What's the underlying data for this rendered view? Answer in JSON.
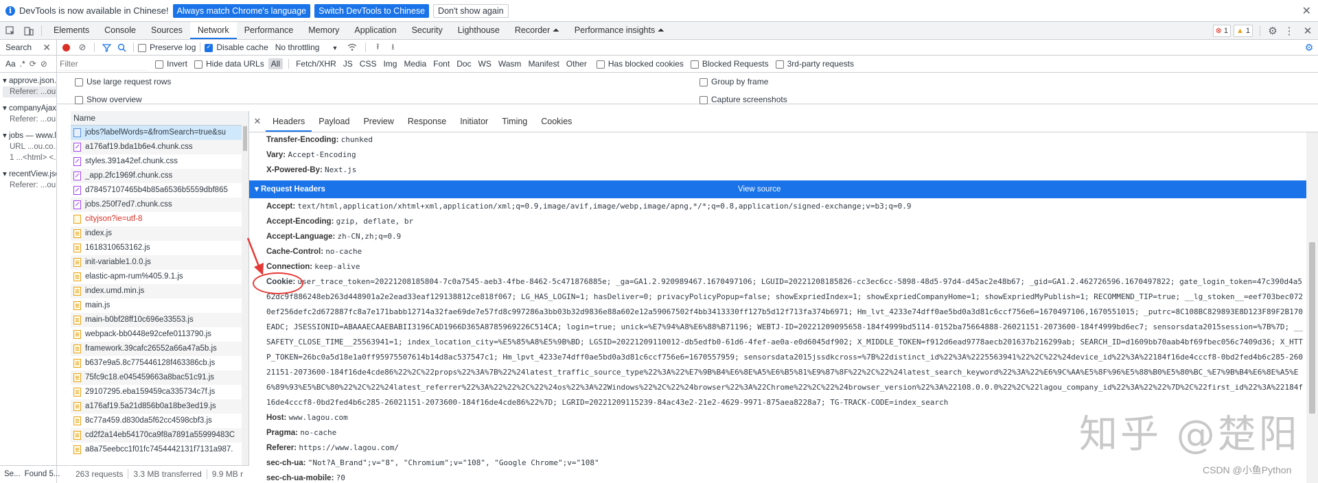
{
  "infobar": {
    "message": "DevTools is now available in Chinese!",
    "btn_match": "Always match Chrome's language",
    "btn_switch": "Switch DevTools to Chinese",
    "btn_dismiss": "Don't show again"
  },
  "main_tabs": [
    "Elements",
    "Console",
    "Sources",
    "Network",
    "Performance",
    "Memory",
    "Application",
    "Security",
    "Lighthouse",
    "Recorder ⏶",
    "Performance insights ⏶"
  ],
  "badges": {
    "errors": "1",
    "warnings": "1"
  },
  "search_panel": {
    "title": "Search",
    "opt_aa": "Aa",
    "opt_regex": ".*",
    "results": [
      {
        "file": "approve.json...",
        "line": "Referer: ...ou..."
      },
      {
        "file": "companyAjax...",
        "line": "Referer: ...ou..."
      },
      {
        "file": "jobs — www.l...",
        "line": "URL ...ou.co...",
        "line2": "1 ...<html> <..."
      },
      {
        "file": "recentView.jso...",
        "line": "Referer: ...ou..."
      }
    ],
    "status_left": "Se...",
    "status_found": "Found 5..."
  },
  "network_toolbar": {
    "preserve_log": "Preserve log",
    "disable_cache": "Disable cache",
    "throttling": "No throttling"
  },
  "filter_bar": {
    "placeholder": "Filter",
    "invert": "Invert",
    "hide_data_urls": "Hide data URLs",
    "types": [
      "All",
      "Fetch/XHR",
      "JS",
      "CSS",
      "Img",
      "Media",
      "Font",
      "Doc",
      "WS",
      "Wasm",
      "Manifest",
      "Other"
    ],
    "has_blocked_cookies": "Has blocked cookies",
    "blocked_requests": "Blocked Requests",
    "third_party": "3rd-party requests"
  },
  "options": {
    "large_rows": "Use large request rows",
    "overview": "Show overview",
    "group_by_frame": "Group by frame",
    "capture_screenshots": "Capture screenshots"
  },
  "request_list": {
    "header": "Name",
    "rows": [
      {
        "name": "jobs?labelWords=&fromSearch=true&su",
        "type": "doc"
      },
      {
        "name": "a176af19.bda1b6e4.chunk.css",
        "type": "css"
      },
      {
        "name": "styles.391a42ef.chunk.css",
        "type": "css"
      },
      {
        "name": "_app.2fc1969f.chunk.css",
        "type": "css"
      },
      {
        "name": "d78457107465b4b85a6536b5559dbf865",
        "type": "css"
      },
      {
        "name": "jobs.250f7ed7.chunk.css",
        "type": "css"
      },
      {
        "name": "cityjson?ie=utf-8",
        "type": "err"
      },
      {
        "name": "index.js",
        "type": "js"
      },
      {
        "name": "1618310653162.js",
        "type": "js"
      },
      {
        "name": "init-variable1.0.0.js",
        "type": "js"
      },
      {
        "name": "elastic-apm-rum%405.9.1.js",
        "type": "js"
      },
      {
        "name": "index.umd.min.js",
        "type": "js"
      },
      {
        "name": "main.js",
        "type": "js"
      },
      {
        "name": "main-b0bf28ff10c696e33553.js",
        "type": "js"
      },
      {
        "name": "webpack-bb0448e92cefe0113790.js",
        "type": "js"
      },
      {
        "name": "framework.39cafc26552a66a47a5b.js",
        "type": "js"
      },
      {
        "name": "b637e9a5.8c775446128f463386cb.js",
        "type": "js"
      },
      {
        "name": "75fc9c18.e045459663a8bac51c91.js",
        "type": "js"
      },
      {
        "name": "29107295.eba159459ca335734c7f.js",
        "type": "js"
      },
      {
        "name": "a176af19.5a21d856b0a18be3ed19.js",
        "type": "js"
      },
      {
        "name": "8c77a459.d830da5f62cc4598cbf3.js",
        "type": "js"
      },
      {
        "name": "cd2f2a14eb54170ca9f8a7891a55999483C",
        "type": "js"
      },
      {
        "name": "a8a75eebcc1f01fc7454442131f7131a987.",
        "type": "js"
      }
    ]
  },
  "statusbar": {
    "requests": "263 requests",
    "transferred": "3.3 MB transferred",
    "resources": "9.9 MB r"
  },
  "detail_tabs": [
    "Headers",
    "Payload",
    "Preview",
    "Response",
    "Initiator",
    "Timing",
    "Cookies"
  ],
  "response_headers": [
    {
      "k": "Transfer-Encoding:",
      "v": "chunked"
    },
    {
      "k": "Vary:",
      "v": "Accept-Encoding"
    },
    {
      "k": "X-Powered-By:",
      "v": "Next.js"
    }
  ],
  "request_section": {
    "title": "Request Headers",
    "view_source": "View source"
  },
  "request_headers_top": [
    {
      "k": "Accept:",
      "v": "text/html,application/xhtml+xml,application/xml;q=0.9,image/avif,image/webp,image/apng,*/*;q=0.8,application/signed-exchange;v=b3;q=0.9"
    },
    {
      "k": "Accept-Encoding:",
      "v": "gzip, deflate, br"
    },
    {
      "k": "Accept-Language:",
      "v": "zh-CN,zh;q=0.9"
    },
    {
      "k": "Cache-Control:",
      "v": "no-cache"
    },
    {
      "k": "Connection:",
      "v": "keep-alive"
    }
  ],
  "cookie": {
    "k": "Cookie:",
    "v": "user_trace_token=20221208185804-7c0a7545-aeb3-4fbe-8462-5c471876885e; _ga=GA1.2.920989467.1670497106; LGUID=20221208185826-cc3ec6cc-5898-48d5-97d4-d45ac2e48b67; _gid=GA1.2.462726596.1670497822; gate_login_token=47c390d4a562dc9f886248eb263d448901a2e2ead33eaf129138812ce818f067; LG_HAS_LOGIN=1; hasDeliver=0; privacyPolicyPopup=false; showExpriedIndex=1; showExpriedCompanyHome=1; showExpriedMyPublish=1; RECOMMEND_TIP=true; __lg_stoken__=eef703bec0720ef256defc2d672887fc8a7e171babb12714a32fae69de7e57fd8c997286a3bb03b32d9836e88a602e12a59067502f4bb3413330ff127b5d12f713fa374b6971; Hm_lvt_4233e74dff0ae5bd0a3d81c6ccf756e6=1670497106,1670551015; _putrc=8C108BC829893E8D123F89F2B170EADC; JSESSIONID=ABAAAECAAEBABII3196CAD1966D365A8785969226C514CA; login=true; unick=%E7%94%A8%E6%88%B71196; WEBTJ-ID=20221209095658-184f4999bd5114-0152ba75664888-26021151-2073600-184f4999bd6ec7; sensorsdata2015session=%7B%7D; __SAFETY_CLOSE_TIME__25563941=1; index_location_city=%E5%85%A8%E5%9B%BD; LGSID=20221209110012-db5edfb0-61d6-4fef-ae0a-e0d6045df902; X_MIDDLE_TOKEN=f912d6ead9778aecb201637b216299ab; SEARCH_ID=d1609bb70aab4bf69fbec056c7409d36; X_HTTP_TOKEN=26bc0a5d18e1a0ff95975507614b14d8ac537547c1; Hm_lpvt_4233e74dff0ae5bd0a3d81c6ccf756e6=1670557959; sensorsdata2015jssdkcross=%7B%22distinct_id%22%3A%2225563941%22%2C%22%24device_id%22%3A%22184f16de4cccf8-0bd2fed4b6c285-26021151-2073600-184f16de4cde86%22%2C%22props%22%3A%7B%22%24latest_traffic_source_type%22%3A%22%E7%9B%B4%E6%8E%A5%E6%B5%81%E9%87%8F%22%2C%22%24latest_search_keyword%22%3A%22%E6%9C%AA%E5%8F%96%E5%88%B0%E5%80%BC_%E7%9B%B4%E6%8E%A5%E6%89%93%E5%BC%80%22%2C%22%24latest_referrer%22%3A%22%22%2C%22%24os%22%3A%22Windows%22%2C%22%24browser%22%3A%22Chrome%22%2C%22%24browser_version%22%3A%22108.0.0.0%22%2C%22lagou_company_id%22%3A%22%22%7D%2C%22first_id%22%3A%22184f16de4cccf8-0bd2fed4b6c285-26021151-2073600-184f16de4cde86%22%7D; LGRID=20221209115239-84ac43e2-21e2-4629-9971-875aea8228a7; TG-TRACK-CODE=index_search"
  },
  "request_headers_bottom": [
    {
      "k": "Host:",
      "v": "www.lagou.com"
    },
    {
      "k": "Pragma:",
      "v": "no-cache"
    },
    {
      "k": "Referer:",
      "v": "https://www.lagou.com/"
    },
    {
      "k": "sec-ch-ua:",
      "v": "\"Not?A_Brand\";v=\"8\", \"Chromium\";v=\"108\", \"Google Chrome\";v=\"108\""
    },
    {
      "k": "sec-ch-ua-mobile:",
      "v": "?0"
    }
  ],
  "watermark": "知乎 @楚阳",
  "csdn_mark": "CSDN @小鱼Python",
  "colors": {
    "accent": "#1a73e8",
    "annotation": "#e53935"
  }
}
